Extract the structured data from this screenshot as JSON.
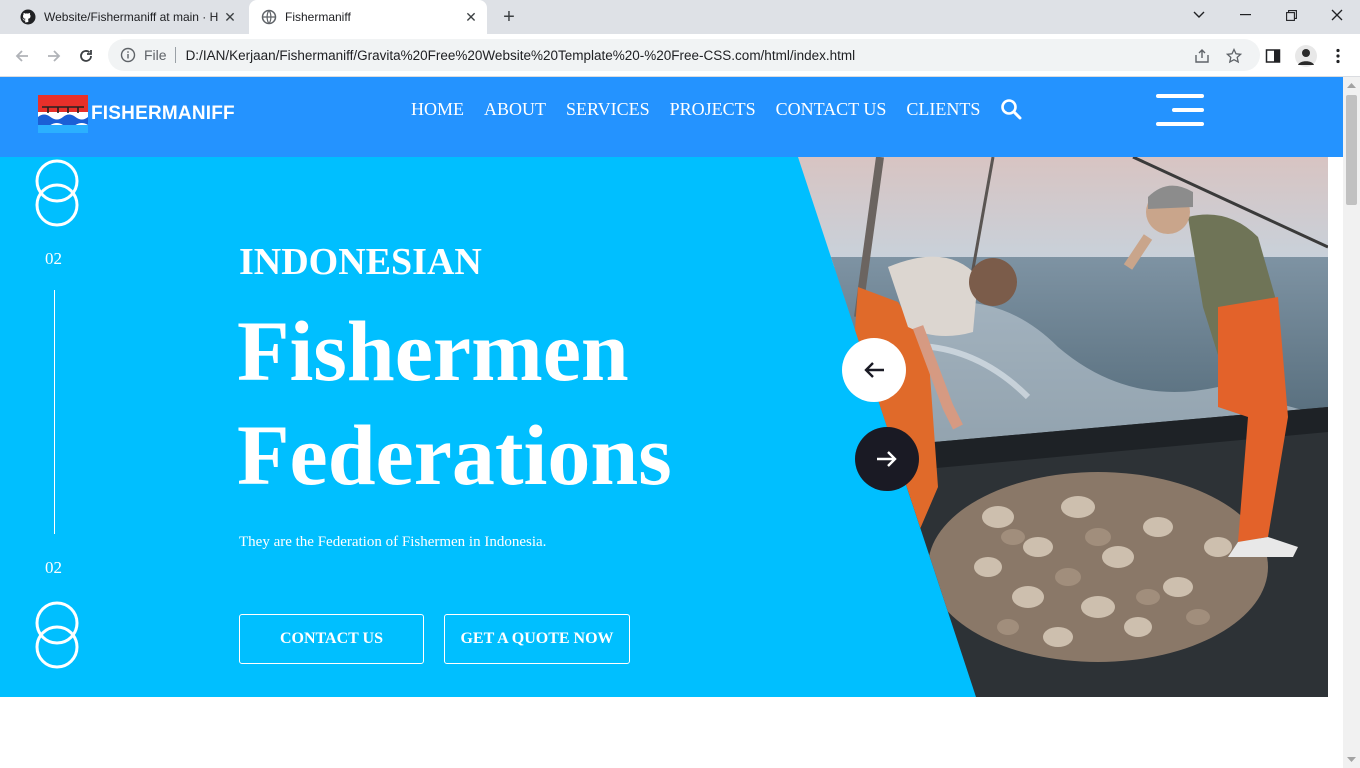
{
  "browser": {
    "tabs": [
      {
        "title": "Website/Fishermaniff at main · H",
        "icon": "github-icon",
        "active": false
      },
      {
        "title": "Fishermaniff",
        "icon": "globe-icon",
        "active": true
      }
    ],
    "omnibox": {
      "scheme_label": "File",
      "url": "D:/IAN/Kerjaan/Fishermaniff/Gravita%20Free%20Website%20Template%20-%20Free-CSS.com/html/index.html"
    }
  },
  "site": {
    "brand": "FISHERMANIFF",
    "nav": [
      "HOME",
      "ABOUT",
      "SERVICES",
      "PROJECTS",
      "CONTACT US",
      "CLIENTS"
    ],
    "colors": {
      "header": "#2493ff",
      "hero": "#00bfff",
      "dark_arrow": "#1a1a24"
    }
  },
  "hero": {
    "kicker": "INDONESIAN",
    "headline_line1": "Fishermen",
    "headline_line2": "Federations",
    "subtitle": "They are the Federation of Fishermen in Indonesia.",
    "primary_button": "CONTACT US",
    "secondary_button": "GET A QUOTE NOW",
    "slide_top": "02",
    "slide_bottom": "02"
  }
}
